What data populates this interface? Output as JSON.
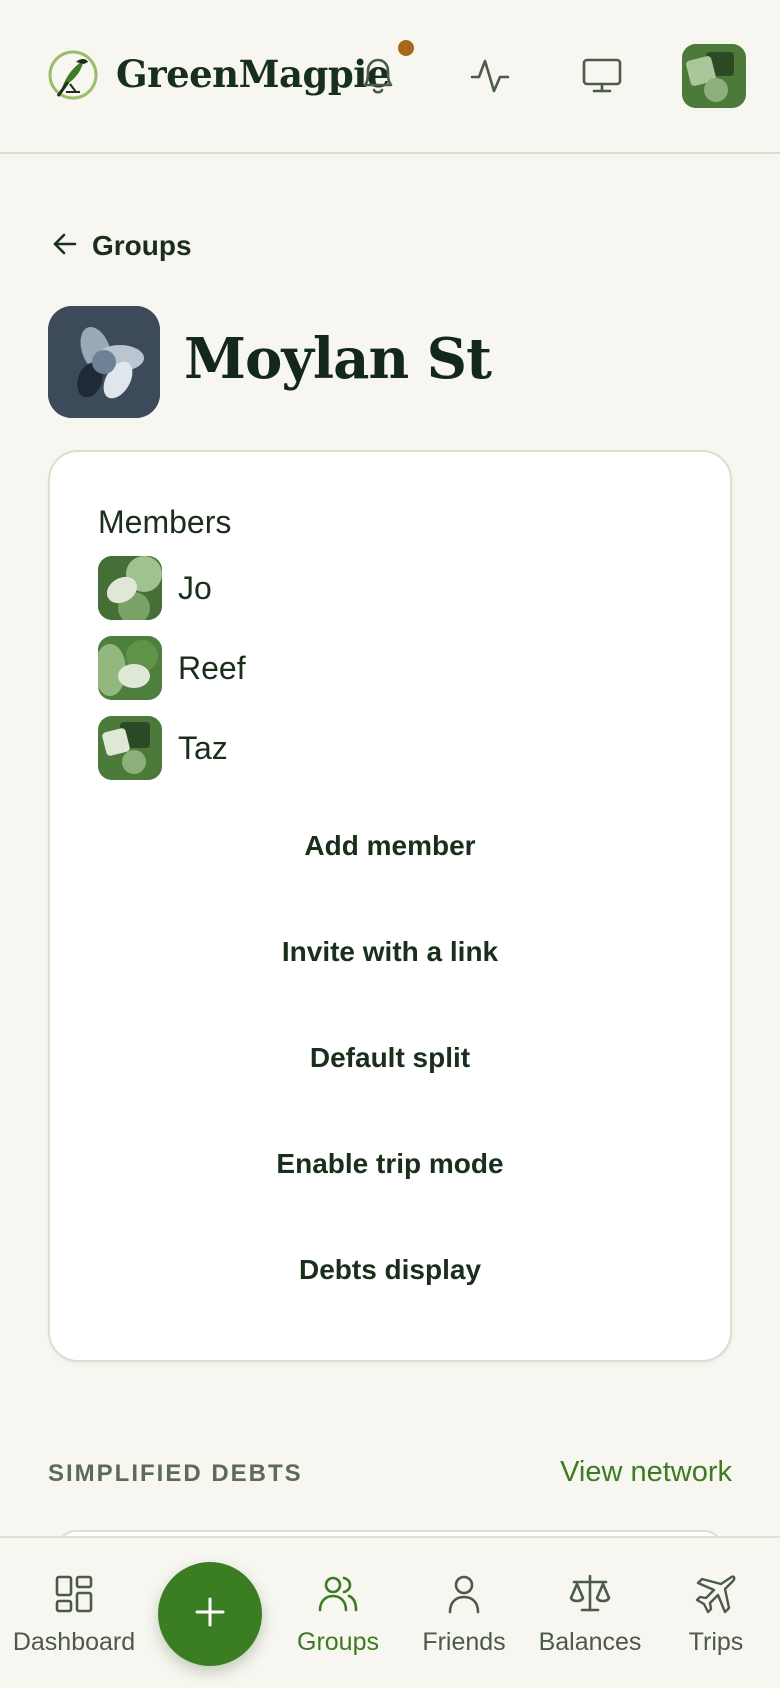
{
  "app": {
    "name": "GreenMagpie"
  },
  "header": {
    "notification_dot_color": "#a7671d",
    "icons": [
      "bell-icon",
      "activity-icon",
      "monitor-icon"
    ]
  },
  "back": {
    "label": "Groups"
  },
  "group": {
    "name": "Moylan St"
  },
  "members": {
    "label": "Members",
    "list": [
      {
        "name": "Jo"
      },
      {
        "name": "Reef"
      },
      {
        "name": "Taz"
      }
    ]
  },
  "actions": {
    "add_member": "Add member",
    "invite_link": "Invite with a link",
    "default_split": "Default split",
    "trip_mode": "Enable trip mode",
    "debts_display": "Debts display"
  },
  "debts": {
    "section_label": "SIMPLIFIED DEBTS",
    "view_network": "View network"
  },
  "nav": {
    "dashboard": "Dashboard",
    "groups": "Groups",
    "friends": "Friends",
    "balances": "Balances",
    "trips": "Trips",
    "active": "Groups"
  },
  "colors": {
    "accent": "#3a7d23",
    "background": "#f7f6f1",
    "text": "#1a2e1c"
  }
}
